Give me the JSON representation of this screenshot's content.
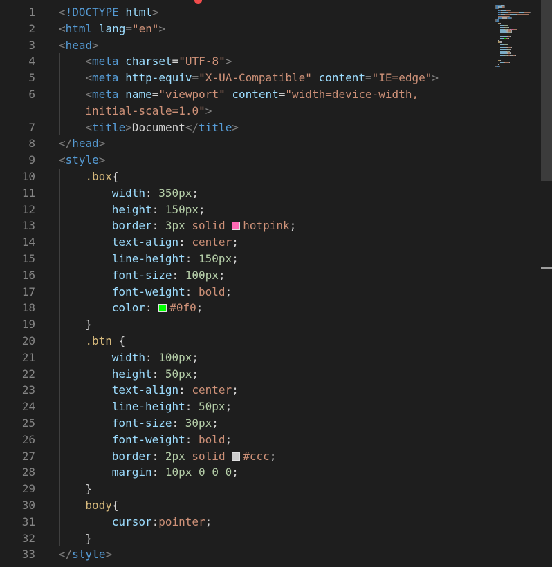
{
  "editor": {
    "swatch_colors": {
      "hotpink": "#ff69b4",
      "green": "#00ff00",
      "gray": "#cccccc"
    },
    "lines": [
      {
        "n": "1",
        "indent": 0,
        "tokens": [
          [
            "br",
            "<"
          ],
          [
            "t",
            "!DOCTYPE"
          ],
          [
            "x",
            " "
          ],
          [
            "a",
            "html"
          ],
          [
            "br",
            ">"
          ]
        ]
      },
      {
        "n": "2",
        "indent": 0,
        "tokens": [
          [
            "br",
            "<"
          ],
          [
            "t",
            "html"
          ],
          [
            "x",
            " "
          ],
          [
            "a",
            "lang"
          ],
          [
            "x",
            "="
          ],
          [
            "s",
            "\"en\""
          ],
          [
            "br",
            ">"
          ]
        ]
      },
      {
        "n": "3",
        "indent": 0,
        "tokens": [
          [
            "br",
            "<"
          ],
          [
            "t",
            "head"
          ],
          [
            "br",
            ">"
          ]
        ]
      },
      {
        "n": "4",
        "indent": 1,
        "tokens": [
          [
            "br",
            "<"
          ],
          [
            "t",
            "meta"
          ],
          [
            "x",
            " "
          ],
          [
            "a",
            "charset"
          ],
          [
            "x",
            "="
          ],
          [
            "s",
            "\"UTF-8\""
          ],
          [
            "br",
            ">"
          ]
        ]
      },
      {
        "n": "5",
        "indent": 1,
        "tokens": [
          [
            "br",
            "<"
          ],
          [
            "t",
            "meta"
          ],
          [
            "x",
            " "
          ],
          [
            "a",
            "http-equiv"
          ],
          [
            "x",
            "="
          ],
          [
            "s",
            "\"X-UA-Compatible\""
          ],
          [
            "x",
            " "
          ],
          [
            "a",
            "content"
          ],
          [
            "x",
            "="
          ],
          [
            "s",
            "\"IE=edge\""
          ],
          [
            "br",
            ">"
          ]
        ]
      },
      {
        "n": "6",
        "indent": 1,
        "tokens": [
          [
            "br",
            "<"
          ],
          [
            "t",
            "meta"
          ],
          [
            "x",
            " "
          ],
          [
            "a",
            "name"
          ],
          [
            "x",
            "="
          ],
          [
            "s",
            "\"viewport\""
          ],
          [
            "x",
            " "
          ],
          [
            "a",
            "content"
          ],
          [
            "x",
            "="
          ],
          [
            "s",
            "\"width=device-width,"
          ]
        ],
        "wrap": [
          [
            "s",
            "initial-scale=1.0\""
          ],
          [
            "br",
            ">"
          ]
        ]
      },
      {
        "n": "7",
        "indent": 1,
        "tokens": [
          [
            "br",
            "<"
          ],
          [
            "t",
            "title"
          ],
          [
            "br",
            ">"
          ],
          [
            "x",
            "Document"
          ],
          [
            "br",
            "</"
          ],
          [
            "t",
            "title"
          ],
          [
            "br",
            ">"
          ]
        ]
      },
      {
        "n": "8",
        "indent": 0,
        "tokens": [
          [
            "br",
            "</"
          ],
          [
            "t",
            "head"
          ],
          [
            "br",
            ">"
          ]
        ]
      },
      {
        "n": "9",
        "indent": 0,
        "tokens": [
          [
            "br",
            "<"
          ],
          [
            "t",
            "style"
          ],
          [
            "br",
            ">"
          ]
        ]
      },
      {
        "n": "10",
        "indent": 1,
        "tokens": [
          [
            "sel",
            ".box"
          ],
          [
            "x",
            "{"
          ]
        ]
      },
      {
        "n": "11",
        "indent": 2,
        "tokens": [
          [
            "p",
            "width"
          ],
          [
            "x",
            ": "
          ],
          [
            "n",
            "350px"
          ],
          [
            "x",
            ";"
          ]
        ]
      },
      {
        "n": "12",
        "indent": 2,
        "tokens": [
          [
            "p",
            "height"
          ],
          [
            "x",
            ": "
          ],
          [
            "n",
            "150px"
          ],
          [
            "x",
            ";"
          ]
        ]
      },
      {
        "n": "13",
        "indent": 2,
        "tokens": [
          [
            "p",
            "border"
          ],
          [
            "x",
            ": "
          ],
          [
            "n",
            "3px"
          ],
          [
            "x",
            " "
          ],
          [
            "v",
            "solid"
          ],
          [
            "x",
            " "
          ],
          [
            "swatch",
            "hotpink"
          ],
          [
            "v",
            "hotpink"
          ],
          [
            "x",
            ";"
          ]
        ]
      },
      {
        "n": "14",
        "indent": 2,
        "tokens": [
          [
            "p",
            "text-align"
          ],
          [
            "x",
            ": "
          ],
          [
            "v",
            "center"
          ],
          [
            "x",
            ";"
          ]
        ]
      },
      {
        "n": "15",
        "indent": 2,
        "tokens": [
          [
            "p",
            "line-height"
          ],
          [
            "x",
            ": "
          ],
          [
            "n",
            "150px"
          ],
          [
            "x",
            ";"
          ]
        ]
      },
      {
        "n": "16",
        "indent": 2,
        "tokens": [
          [
            "p",
            "font-size"
          ],
          [
            "x",
            ": "
          ],
          [
            "n",
            "100px"
          ],
          [
            "x",
            ";"
          ]
        ]
      },
      {
        "n": "17",
        "indent": 2,
        "tokens": [
          [
            "p",
            "font-weight"
          ],
          [
            "x",
            ": "
          ],
          [
            "v",
            "bold"
          ],
          [
            "x",
            ";"
          ]
        ]
      },
      {
        "n": "18",
        "indent": 2,
        "tokens": [
          [
            "p",
            "color"
          ],
          [
            "x",
            ": "
          ],
          [
            "swatch",
            "green"
          ],
          [
            "v",
            "#0f0"
          ],
          [
            "x",
            ";"
          ]
        ]
      },
      {
        "n": "19",
        "indent": 1,
        "tokens": [
          [
            "x",
            "}"
          ]
        ]
      },
      {
        "n": "20",
        "indent": 1,
        "tokens": [
          [
            "sel",
            ".btn"
          ],
          [
            "x",
            " {"
          ]
        ]
      },
      {
        "n": "21",
        "indent": 2,
        "tokens": [
          [
            "p",
            "width"
          ],
          [
            "x",
            ": "
          ],
          [
            "n",
            "100px"
          ],
          [
            "x",
            ";"
          ]
        ]
      },
      {
        "n": "22",
        "indent": 2,
        "tokens": [
          [
            "p",
            "height"
          ],
          [
            "x",
            ": "
          ],
          [
            "n",
            "50px"
          ],
          [
            "x",
            ";"
          ]
        ]
      },
      {
        "n": "23",
        "indent": 2,
        "tokens": [
          [
            "p",
            "text-align"
          ],
          [
            "x",
            ": "
          ],
          [
            "v",
            "center"
          ],
          [
            "x",
            ";"
          ]
        ]
      },
      {
        "n": "24",
        "indent": 2,
        "tokens": [
          [
            "p",
            "line-height"
          ],
          [
            "x",
            ": "
          ],
          [
            "n",
            "50px"
          ],
          [
            "x",
            ";"
          ]
        ]
      },
      {
        "n": "25",
        "indent": 2,
        "tokens": [
          [
            "p",
            "font-size"
          ],
          [
            "x",
            ": "
          ],
          [
            "n",
            "30px"
          ],
          [
            "x",
            ";"
          ]
        ]
      },
      {
        "n": "26",
        "indent": 2,
        "tokens": [
          [
            "p",
            "font-weight"
          ],
          [
            "x",
            ": "
          ],
          [
            "v",
            "bold"
          ],
          [
            "x",
            ";"
          ]
        ]
      },
      {
        "n": "27",
        "indent": 2,
        "tokens": [
          [
            "p",
            "border"
          ],
          [
            "x",
            ": "
          ],
          [
            "n",
            "2px"
          ],
          [
            "x",
            " "
          ],
          [
            "v",
            "solid"
          ],
          [
            "x",
            " "
          ],
          [
            "swatch",
            "gray"
          ],
          [
            "v",
            "#ccc"
          ],
          [
            "x",
            ";"
          ]
        ]
      },
      {
        "n": "28",
        "indent": 2,
        "tokens": [
          [
            "p",
            "margin"
          ],
          [
            "x",
            ": "
          ],
          [
            "n",
            "10px"
          ],
          [
            "x",
            " "
          ],
          [
            "n",
            "0"
          ],
          [
            "x",
            " "
          ],
          [
            "n",
            "0"
          ],
          [
            "x",
            " "
          ],
          [
            "n",
            "0"
          ],
          [
            "x",
            ";"
          ]
        ]
      },
      {
        "n": "29",
        "indent": 1,
        "tokens": [
          [
            "x",
            "}"
          ]
        ]
      },
      {
        "n": "30",
        "indent": 1,
        "tokens": [
          [
            "sel",
            "body"
          ],
          [
            "x",
            "{"
          ]
        ]
      },
      {
        "n": "31",
        "indent": 2,
        "tokens": [
          [
            "p",
            "cursor"
          ],
          [
            "x",
            ":"
          ],
          [
            "v",
            "pointer"
          ],
          [
            "x",
            ";"
          ]
        ]
      },
      {
        "n": "32",
        "indent": 1,
        "tokens": [
          [
            "x",
            "}"
          ]
        ]
      },
      {
        "n": "33",
        "indent": 0,
        "tokens": [
          [
            "br",
            "</"
          ],
          [
            "t",
            "style"
          ],
          [
            "br",
            ">"
          ]
        ]
      }
    ]
  }
}
